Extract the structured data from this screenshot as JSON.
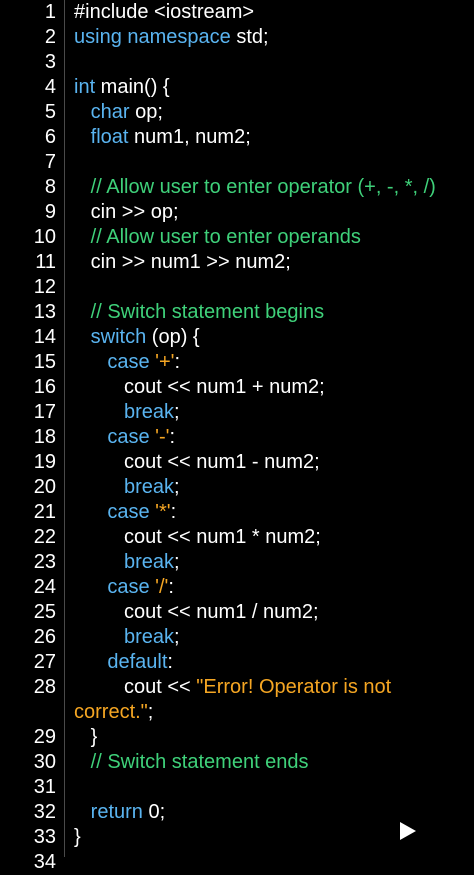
{
  "editor": {
    "lines": [
      {
        "n": "1",
        "parts": [
          {
            "t": "#include <iostream>",
            "c": "pp"
          }
        ]
      },
      {
        "n": "2",
        "parts": [
          {
            "t": "using namespace",
            "c": "kw"
          },
          {
            "t": " std;",
            "c": "tx"
          }
        ]
      },
      {
        "n": "3",
        "parts": []
      },
      {
        "n": "4",
        "parts": [
          {
            "t": "int",
            "c": "kw"
          },
          {
            "t": " main() {",
            "c": "tx"
          }
        ]
      },
      {
        "n": "5",
        "parts": [
          {
            "t": "   ",
            "c": "tx"
          },
          {
            "t": "char",
            "c": "kw"
          },
          {
            "t": " op;",
            "c": "tx"
          }
        ]
      },
      {
        "n": "6",
        "parts": [
          {
            "t": "   ",
            "c": "tx"
          },
          {
            "t": "float",
            "c": "kw"
          },
          {
            "t": " num1, num2;",
            "c": "tx"
          }
        ]
      },
      {
        "n": "7",
        "parts": []
      },
      {
        "n": "8",
        "parts": [
          {
            "t": "   ",
            "c": "tx"
          },
          {
            "t": "// Allow user to enter operator (+, -, *, /)",
            "c": "cm"
          }
        ]
      },
      {
        "n": "9",
        "parts": [
          {
            "t": "   cin >> op;",
            "c": "tx"
          }
        ]
      },
      {
        "n": "10",
        "parts": [
          {
            "t": "   ",
            "c": "tx"
          },
          {
            "t": "// Allow user to enter operands",
            "c": "cm"
          }
        ]
      },
      {
        "n": "11",
        "parts": [
          {
            "t": "   cin >> num1 >> num2;",
            "c": "tx"
          }
        ]
      },
      {
        "n": "12",
        "parts": []
      },
      {
        "n": "13",
        "parts": [
          {
            "t": "   ",
            "c": "tx"
          },
          {
            "t": "// Switch statement begins",
            "c": "cm"
          }
        ]
      },
      {
        "n": "14",
        "parts": [
          {
            "t": "   ",
            "c": "tx"
          },
          {
            "t": "switch",
            "c": "kw"
          },
          {
            "t": " (op) {",
            "c": "tx"
          }
        ]
      },
      {
        "n": "15",
        "parts": [
          {
            "t": "      ",
            "c": "tx"
          },
          {
            "t": "case",
            "c": "kw"
          },
          {
            "t": " ",
            "c": "tx"
          },
          {
            "t": "'+'",
            "c": "st"
          },
          {
            "t": ":",
            "c": "tx"
          }
        ]
      },
      {
        "n": "16",
        "parts": [
          {
            "t": "         cout << num1 + num2;",
            "c": "tx"
          }
        ]
      },
      {
        "n": "17",
        "parts": [
          {
            "t": "         ",
            "c": "tx"
          },
          {
            "t": "break",
            "c": "kw"
          },
          {
            "t": ";",
            "c": "tx"
          }
        ]
      },
      {
        "n": "18",
        "parts": [
          {
            "t": "      ",
            "c": "tx"
          },
          {
            "t": "case",
            "c": "kw"
          },
          {
            "t": " ",
            "c": "tx"
          },
          {
            "t": "'-'",
            "c": "st"
          },
          {
            "t": ":",
            "c": "tx"
          }
        ]
      },
      {
        "n": "19",
        "parts": [
          {
            "t": "         cout << num1 - num2;",
            "c": "tx"
          }
        ]
      },
      {
        "n": "20",
        "parts": [
          {
            "t": "         ",
            "c": "tx"
          },
          {
            "t": "break",
            "c": "kw"
          },
          {
            "t": ";",
            "c": "tx"
          }
        ]
      },
      {
        "n": "21",
        "parts": [
          {
            "t": "      ",
            "c": "tx"
          },
          {
            "t": "case",
            "c": "kw"
          },
          {
            "t": " ",
            "c": "tx"
          },
          {
            "t": "'*'",
            "c": "st"
          },
          {
            "t": ":",
            "c": "tx"
          }
        ]
      },
      {
        "n": "22",
        "parts": [
          {
            "t": "         cout << num1 * num2;",
            "c": "tx"
          }
        ]
      },
      {
        "n": "23",
        "parts": [
          {
            "t": "         ",
            "c": "tx"
          },
          {
            "t": "break",
            "c": "kw"
          },
          {
            "t": ";",
            "c": "tx"
          }
        ]
      },
      {
        "n": "24",
        "parts": [
          {
            "t": "      ",
            "c": "tx"
          },
          {
            "t": "case",
            "c": "kw"
          },
          {
            "t": " ",
            "c": "tx"
          },
          {
            "t": "'/'",
            "c": "st"
          },
          {
            "t": ":",
            "c": "tx"
          }
        ]
      },
      {
        "n": "25",
        "parts": [
          {
            "t": "         cout << num1 / num2;",
            "c": "tx"
          }
        ]
      },
      {
        "n": "26",
        "parts": [
          {
            "t": "         ",
            "c": "tx"
          },
          {
            "t": "break",
            "c": "kw"
          },
          {
            "t": ";",
            "c": "tx"
          }
        ]
      },
      {
        "n": "27",
        "parts": [
          {
            "t": "      ",
            "c": "tx"
          },
          {
            "t": "default",
            "c": "kw"
          },
          {
            "t": ":",
            "c": "tx"
          }
        ]
      },
      {
        "n": "28",
        "parts": [
          {
            "t": "         cout << ",
            "c": "tx"
          },
          {
            "t": "\"Error! Operator is not",
            "c": "st"
          }
        ]
      },
      {
        "n": "",
        "parts": [
          {
            "t": "correct.\"",
            "c": "st"
          },
          {
            "t": ";",
            "c": "tx"
          }
        ]
      },
      {
        "n": "29",
        "parts": [
          {
            "t": "   }",
            "c": "tx"
          }
        ]
      },
      {
        "n": "30",
        "parts": [
          {
            "t": "   ",
            "c": "tx"
          },
          {
            "t": "// Switch statement ends",
            "c": "cm"
          }
        ]
      },
      {
        "n": "31",
        "parts": []
      },
      {
        "n": "32",
        "parts": [
          {
            "t": "   ",
            "c": "tx"
          },
          {
            "t": "return",
            "c": "kw"
          },
          {
            "t": " 0;",
            "c": "tx"
          }
        ]
      },
      {
        "n": "33",
        "parts": [
          {
            "t": "}",
            "c": "tx"
          }
        ]
      },
      {
        "n": "34",
        "parts": []
      }
    ]
  },
  "toolbar": {
    "play_icon": "play-icon"
  },
  "colors": {
    "background": "#000000",
    "keyword": "#5ab4f0",
    "comment": "#3fd17a",
    "string": "#f5a623",
    "text": "#ffffff",
    "gutter_line": "#4a4a4a"
  }
}
